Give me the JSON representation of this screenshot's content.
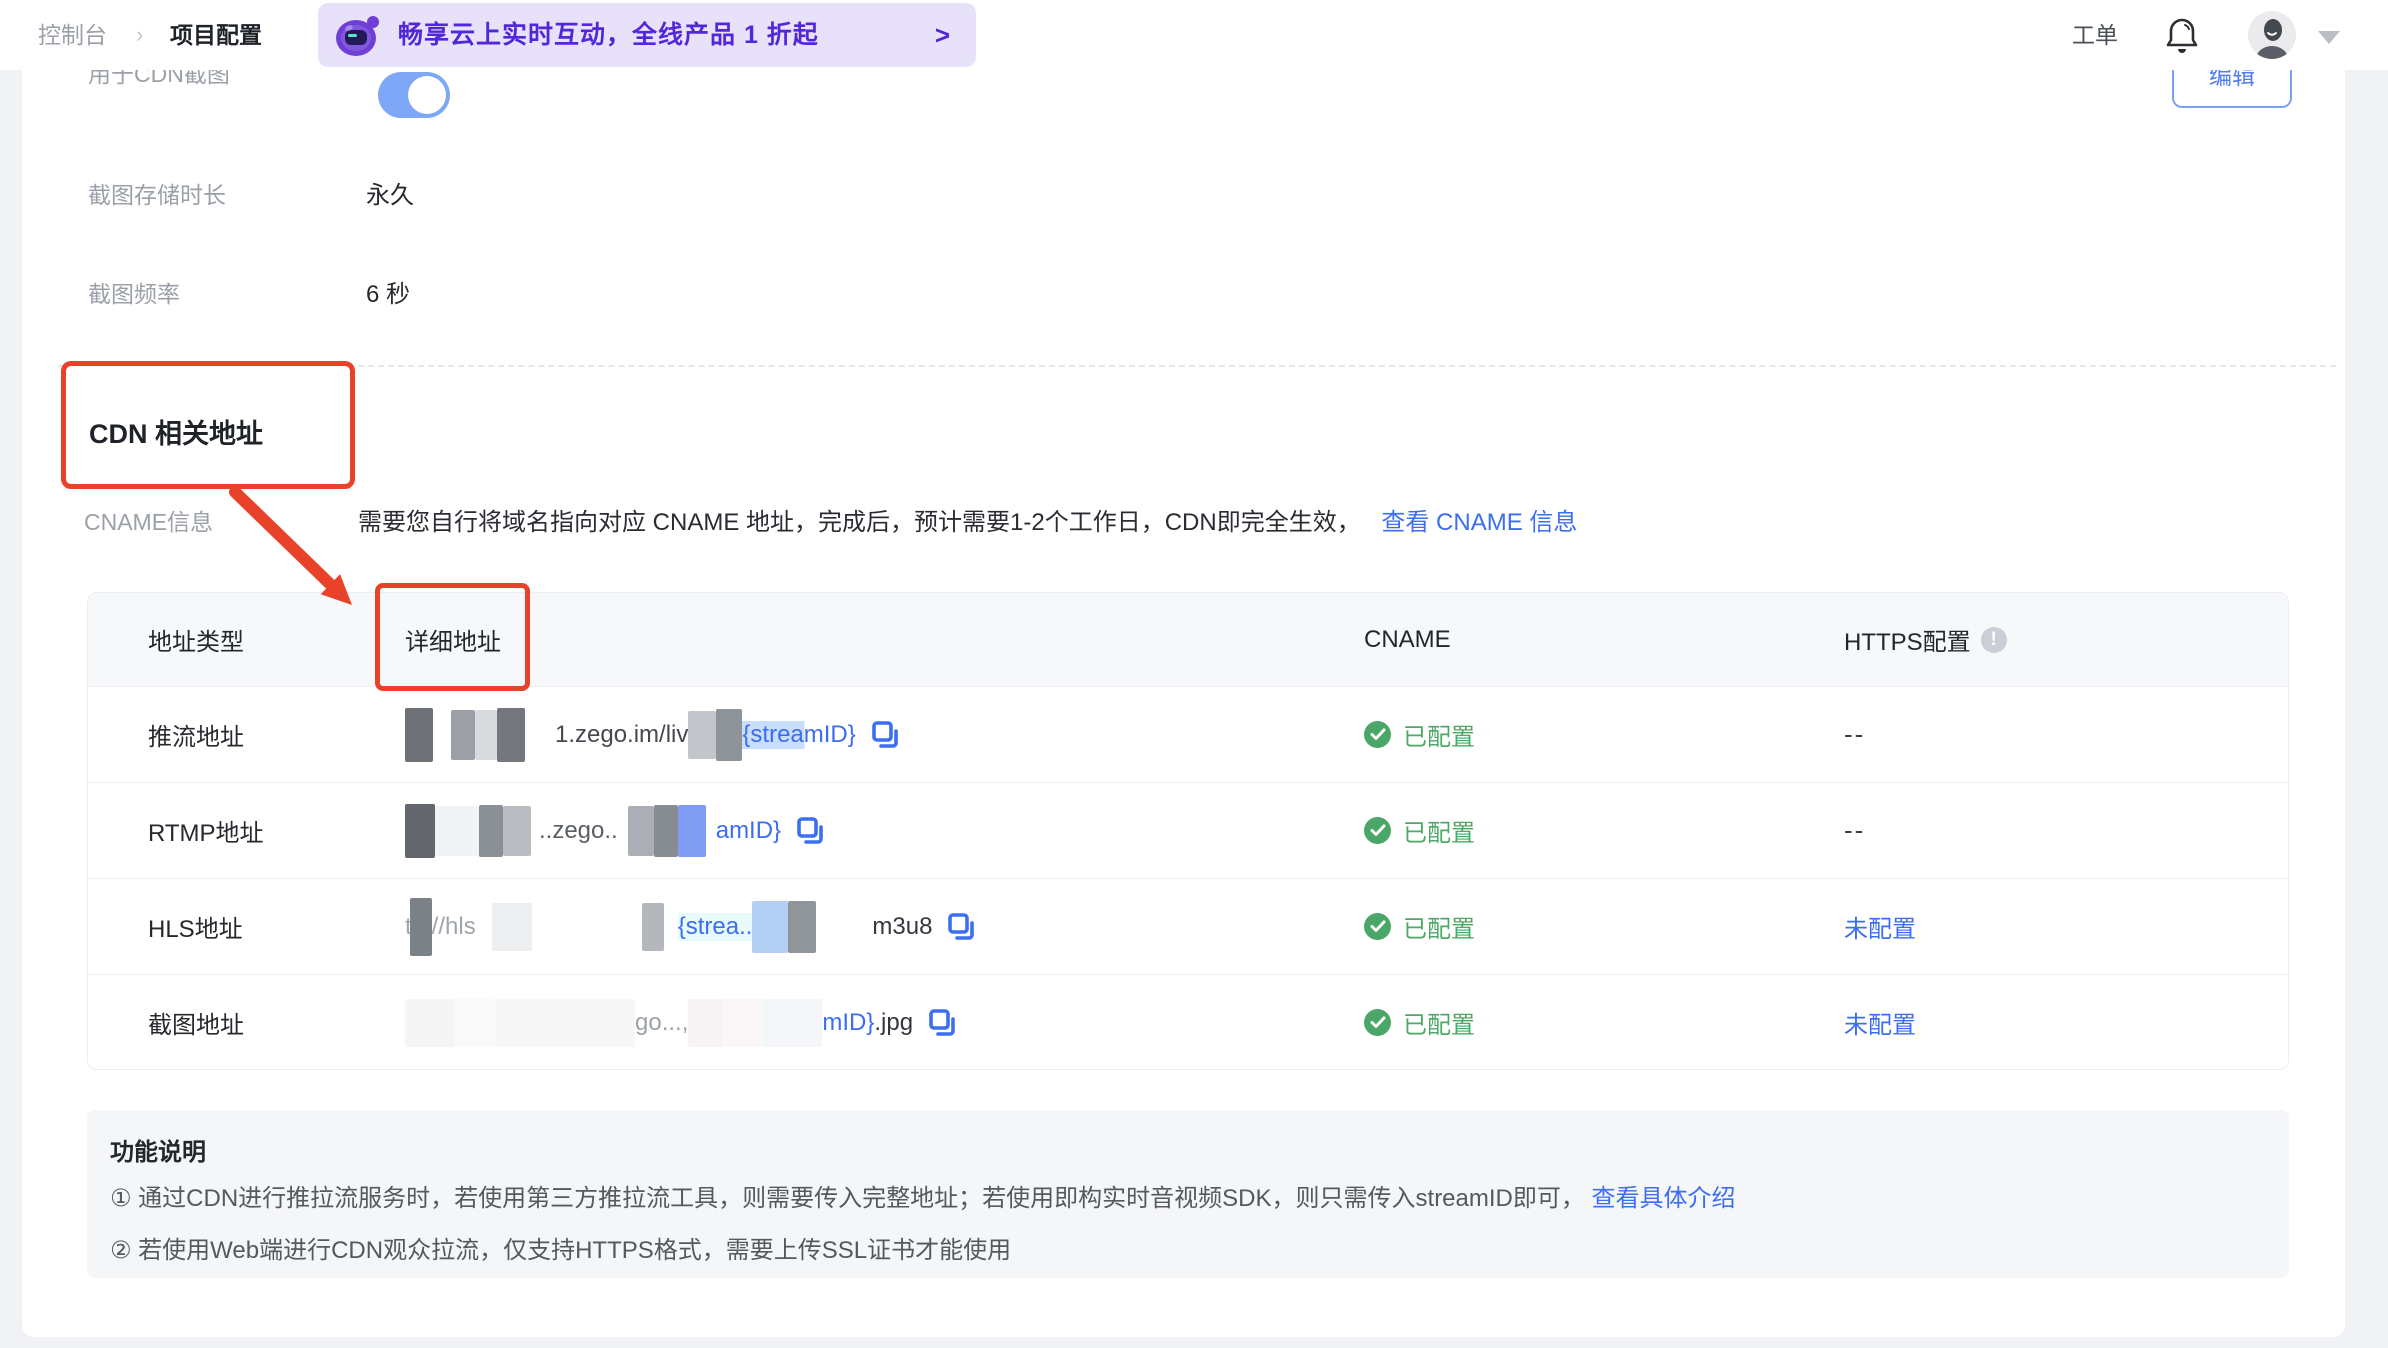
{
  "colors": {
    "accent_blue": "#3B6EF0",
    "success_green": "#4BA767",
    "annotation_red": "#E8432A",
    "banner_purple_text": "#5127D9",
    "banner_purple_bg": "#E7E2FA",
    "toggle_blue": "#7FA7F7"
  },
  "header": {
    "breadcrumb": {
      "root": "控制台",
      "separator": "›",
      "current": "项目配置"
    },
    "banner": {
      "text": "畅享云上实时互动，全线产品 1 折起",
      "arrow": ">"
    },
    "tickets": "工单"
  },
  "settings": {
    "edit_button": "编辑",
    "cdn_screenshot_label": "用于CDN截图",
    "cdn_screenshot_toggle": "on",
    "storage_label": "截图存储时长",
    "storage_value": "永久",
    "frequency_label": "截图频率",
    "frequency_value": "6 秒"
  },
  "cdn_section": {
    "title": "CDN 相关地址",
    "cname_label": "CNAME信息",
    "cname_desc": "需要您自行将域名指向对应 CNAME 地址，完成后，预计需要1-2个工作日，CDN即完全生效，",
    "cname_link": "查看 CNAME 信息"
  },
  "table": {
    "headers": {
      "type": "地址类型",
      "detail": "详细地址",
      "cname": "CNAME",
      "https": "HTTPS配置"
    },
    "rows": [
      {
        "type": "推流地址",
        "frag_mid": "1.zego.im/liv",
        "frag_tail": "{streamID}",
        "cname": "已配置",
        "https": "--"
      },
      {
        "type": "RTMP地址",
        "frag_mid": "..zego..",
        "frag_tail": "amID}",
        "cname": "已配置",
        "https": "--"
      },
      {
        "type": "HLS地址",
        "frag_head": "tp://hls",
        "frag_mid": "{strea..",
        "frag_tail": "m3u8",
        "cname": "已配置",
        "https": "未配置"
      },
      {
        "type": "截图地址",
        "frag_mid": "go...,",
        "frag_tail": "mID}",
        "frag_ext": ".jpg",
        "cname": "已配置",
        "https": "未配置"
      }
    ]
  },
  "notes": {
    "title": "功能说明",
    "item1": "① 通过CDN进行推拉流服务时，若使用第三方推拉流工具，则需要传入完整地址；若使用即构实时音视频SDK，则只需传入streamID即可，",
    "item1_link": "查看具体介绍",
    "item2": "② 若使用Web端进行CDN观众拉流，仅支持HTTPS格式，需要上传SSL证书才能使用"
  }
}
